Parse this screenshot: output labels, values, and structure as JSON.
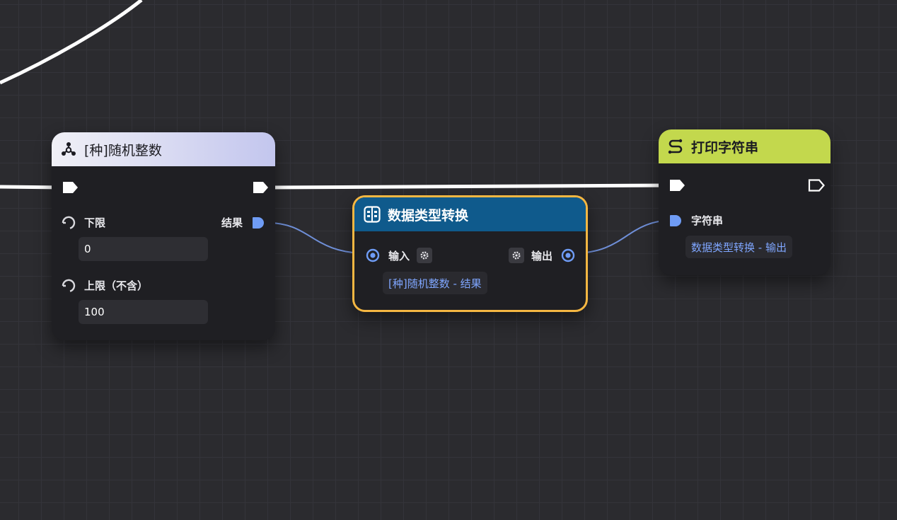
{
  "nodes": {
    "random": {
      "title": "[种]随机整数",
      "header_color": "#c3c6ee",
      "icon": "molecule-icon",
      "output_label": "结果",
      "lower_label": "下限",
      "lower_value": "0",
      "upper_label": "上限（不含）",
      "upper_value": "100"
    },
    "convert": {
      "title": "数据类型转换",
      "header_color": "#0f5a8c",
      "border_color": "#f5b742",
      "icon": "convert-icon",
      "input_label": "输入",
      "output_label": "输出",
      "input_ref": "[种]随机整数 - 结果"
    },
    "print": {
      "title": "打印字符串",
      "header_color": "#c3d84d",
      "icon": "string-icon",
      "string_label": "字符串",
      "string_ref": "数据类型转换 - 输出"
    }
  },
  "colors": {
    "data_port": "#6f9cf5",
    "wire_data": "#6f8fd8",
    "wire_exec": "#ffffff"
  }
}
